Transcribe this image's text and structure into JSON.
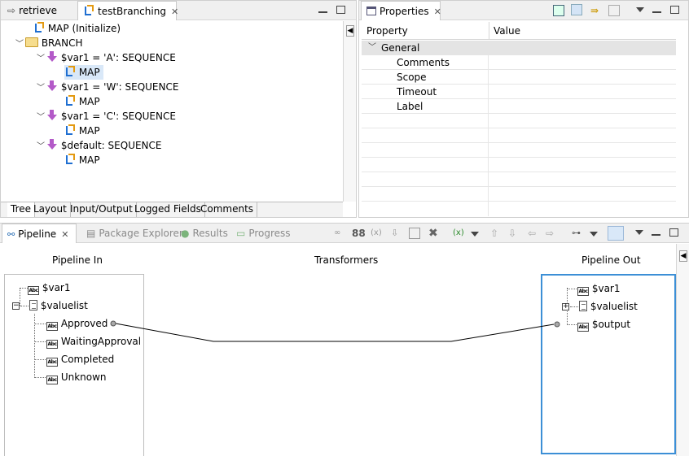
{
  "editor": {
    "tabs": [
      {
        "label": "retrieve"
      },
      {
        "label": "testBranching"
      }
    ],
    "tree": [
      {
        "label": "MAP (Initialize)"
      },
      {
        "label": "BRANCH"
      },
      {
        "label": "$var1 = 'A': SEQUENCE"
      },
      {
        "label": "MAP"
      },
      {
        "label": "$var1 = 'W': SEQUENCE"
      },
      {
        "label": "MAP"
      },
      {
        "label": "$var1 = 'C': SEQUENCE"
      },
      {
        "label": "MAP"
      },
      {
        "label": "$default: SEQUENCE"
      },
      {
        "label": "MAP"
      }
    ],
    "bottom_tabs": [
      {
        "label": "Tree"
      },
      {
        "label": "Layout"
      },
      {
        "label": "Input/Output"
      },
      {
        "label": "Logged Fields"
      },
      {
        "label": "Comments"
      }
    ]
  },
  "properties": {
    "tab_label": "Properties",
    "headers": {
      "property": "Property",
      "value": "Value"
    },
    "group": "General",
    "rows": [
      {
        "label": "Comments"
      },
      {
        "label": "Scope"
      },
      {
        "label": "Timeout"
      },
      {
        "label": "Label"
      }
    ]
  },
  "bottom_panel": {
    "tabs": [
      {
        "label": "Pipeline"
      },
      {
        "label": "Package Explorer"
      },
      {
        "label": "Results"
      },
      {
        "label": "Progress"
      }
    ],
    "headers": {
      "pipeline_in": "Pipeline In",
      "transformers": "Transformers",
      "pipeline_out": "Pipeline Out"
    },
    "pipeline_in": [
      {
        "label": "$var1"
      },
      {
        "label": "$valuelist"
      },
      {
        "label": "Approved"
      },
      {
        "label": "WaitingApproval"
      },
      {
        "label": "Completed"
      },
      {
        "label": "Unknown"
      }
    ],
    "pipeline_out": [
      {
        "label": "$var1"
      },
      {
        "label": "$valuelist"
      },
      {
        "label": "$output"
      }
    ],
    "abc_label": "Abc"
  },
  "colors": {
    "selection": "#d9e8f8",
    "focus_border": "#3c8fd6",
    "sequence_icon": "#b35ac8",
    "map_icon_blue": "#1f6fd1",
    "map_icon_orange": "#e39a12"
  }
}
